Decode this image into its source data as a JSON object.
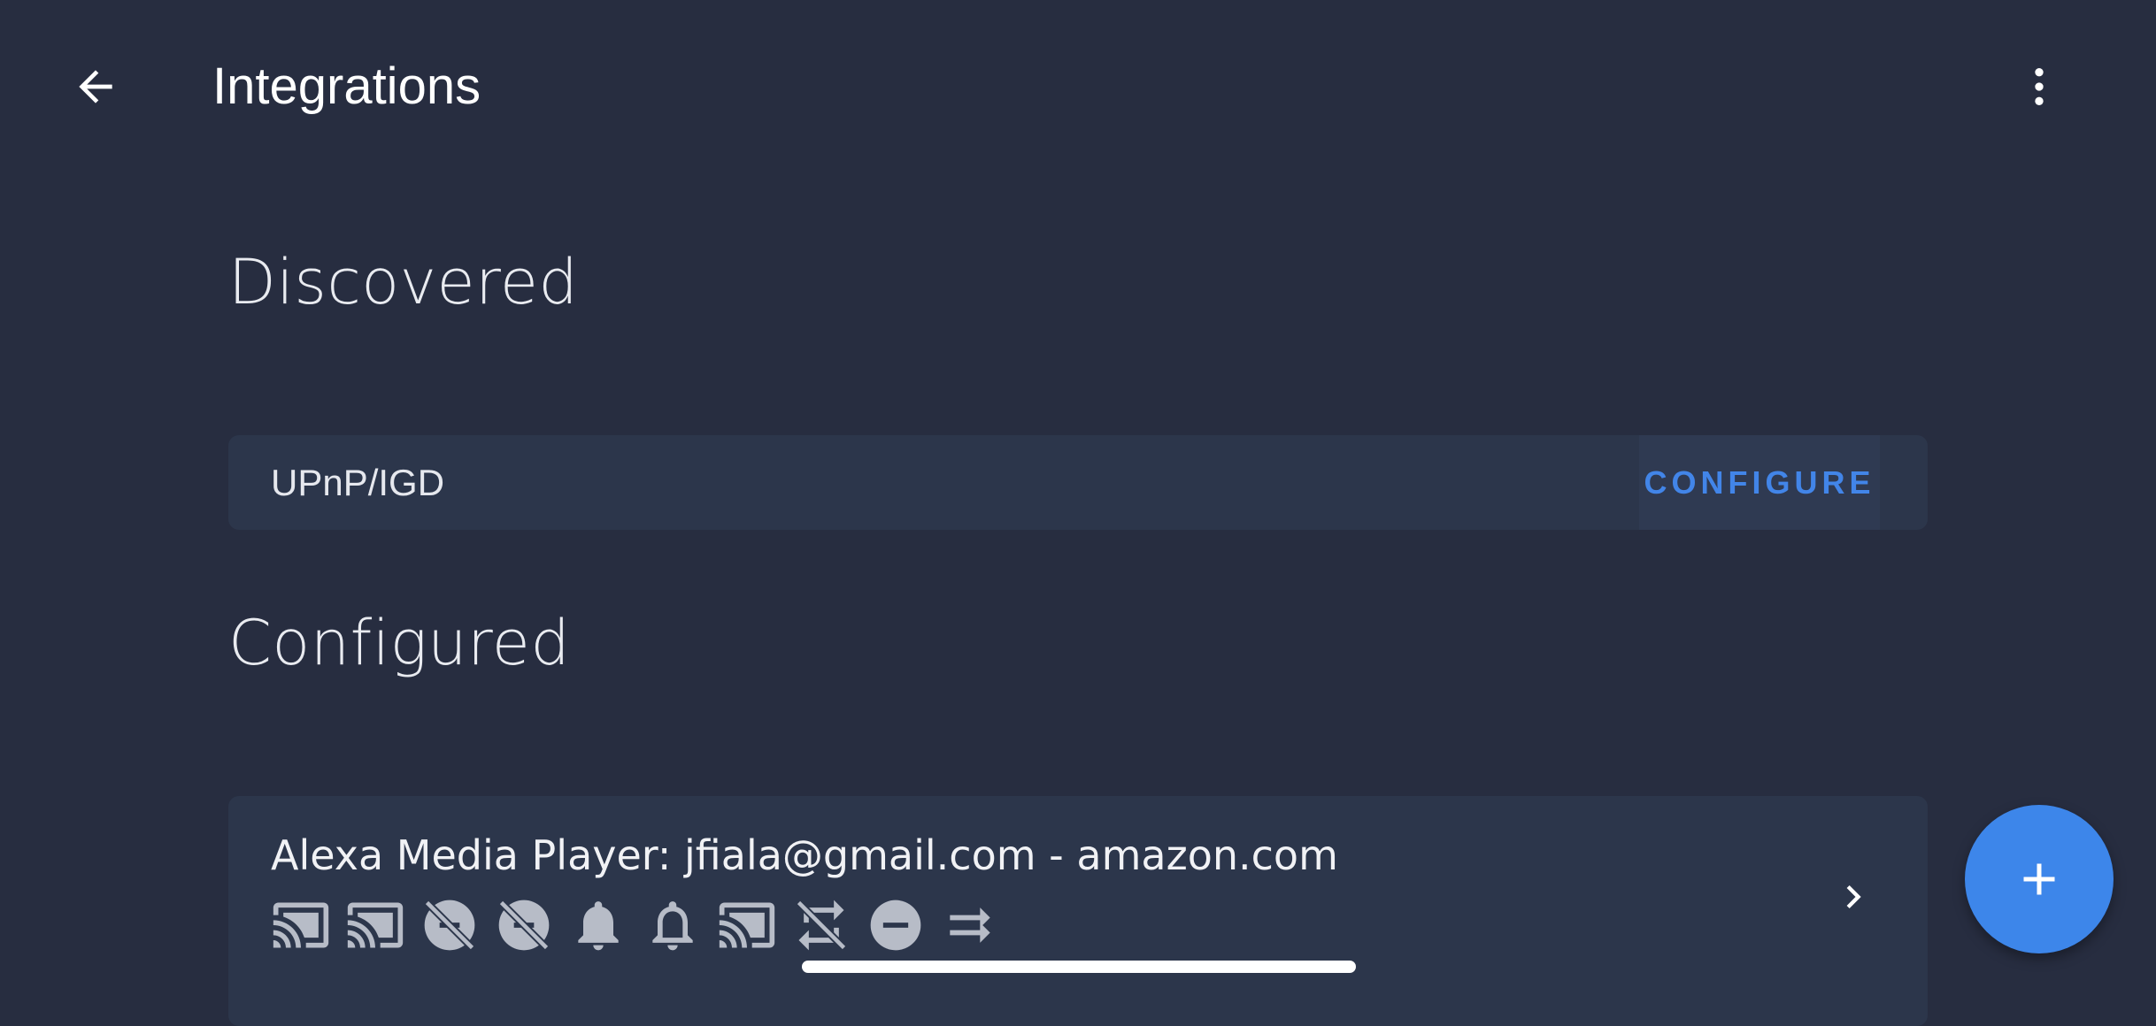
{
  "header": {
    "title": "Integrations",
    "back_icon": "arrow-left-icon",
    "menu_icon": "dots-vertical-icon"
  },
  "discovered": {
    "heading": "Discovered",
    "items": [
      {
        "name": "UPnP/IGD",
        "action_label": "CONFIGURE"
      }
    ]
  },
  "configured": {
    "heading": "Configured",
    "items": [
      {
        "name": "Alexa Media Player: jfiala@gmail.com - amazon.com",
        "entity_icons": [
          "cast-icon",
          "cast-icon",
          "alarm-off-icon",
          "alarm-off-icon",
          "bell-icon",
          "bell-outline-icon",
          "cast-icon",
          "repeat-off-icon",
          "minus-circle-icon",
          "shuffle-disabled-icon"
        ]
      }
    ]
  },
  "fab": {
    "icon": "plus-icon"
  },
  "colors": {
    "background": "#272d40",
    "card": "#2c364b",
    "accent": "#4285e8",
    "fab": "#3d86ea"
  }
}
